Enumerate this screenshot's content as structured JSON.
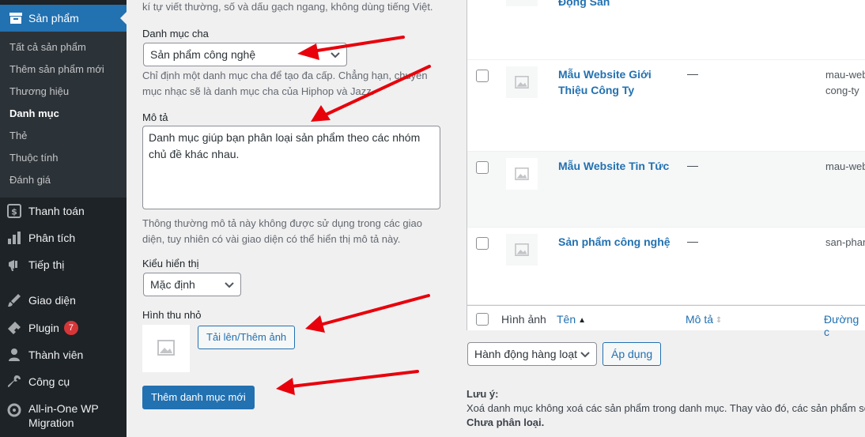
{
  "sidebar": {
    "current_menu": "Sản phẩm",
    "submenu": [
      {
        "label": "Tất cả sản phẩm",
        "current": false
      },
      {
        "label": "Thêm sản phẩm mới",
        "current": false
      },
      {
        "label": "Thương hiệu",
        "current": false
      },
      {
        "label": "Danh mục",
        "current": true
      },
      {
        "label": "Thẻ",
        "current": false
      },
      {
        "label": "Thuộc tính",
        "current": false
      },
      {
        "label": "Đánh giá",
        "current": false
      }
    ],
    "menu": [
      {
        "label": "Thanh toán",
        "icon": "payment-icon"
      },
      {
        "label": "Phân tích",
        "icon": "analytics-icon"
      },
      {
        "label": "Tiếp thị",
        "icon": "marketing-icon"
      },
      {
        "label": "Giao diện",
        "icon": "appearance-icon"
      },
      {
        "label": "Plugin",
        "icon": "plugin-icon",
        "badge": "7"
      },
      {
        "label": "Thành viên",
        "icon": "users-icon"
      },
      {
        "label": "Công cụ",
        "icon": "tools-icon"
      },
      {
        "label": "All-in-One WP Migration",
        "label_line1": "All-in-One WP",
        "label_line2": "Migration",
        "icon": "migration-icon"
      }
    ]
  },
  "form": {
    "slug_help": "kí tự viết thường, số và dấu gạch ngang, không dùng tiếng Việt.",
    "parent_label": "Danh mục cha",
    "parent_value": "Sản phẩm công nghệ",
    "parent_help_line1": "Chỉ định một danh mục cha để tạo đa cấp. Chẳng hạn, chuyên",
    "parent_help_line2": "mục nhạc sẽ là danh mục cha của Hiphop và Jazz.",
    "desc_label": "Mô tả",
    "desc_value_line1": "Danh mục giúp bạn phân loại sản phẩm theo các nhóm",
    "desc_value_line2": "chủ đề khác nhau.",
    "desc_help_line1": "Thông thường mô tả này không được sử dụng trong các giao",
    "desc_help_line2": "diện, tuy nhiên có vài giao diện có thể hiển thị mô tả này.",
    "display_label": "Kiểu hiển thị",
    "display_value": "Mặc định",
    "thumb_label": "Hình thu nhỏ",
    "upload_button": "Tải lên/Thêm ảnh",
    "submit_button": "Thêm danh mục mới"
  },
  "table": {
    "rows": [
      {
        "name": "Động Sản",
        "desc": "",
        "slug": ""
      },
      {
        "name_line1": "Mẫu Website Giới",
        "name_line2": "Thiệu Công Ty",
        "desc": "—",
        "slug_line1": "mau-web",
        "slug_line2": "cong-ty"
      },
      {
        "name": "Mẫu Website Tin Tức",
        "desc": "—",
        "slug": "mau-web"
      },
      {
        "name": "Sản phẩm công nghệ",
        "desc": "—",
        "slug": "san-phar"
      }
    ],
    "footer": {
      "image": "Hình ảnh",
      "name": "Tên",
      "desc": "Mô tả",
      "slug": "Đường c"
    },
    "bulk_action": "Hành động hàng loạt",
    "apply_button": "Áp dụng"
  },
  "note": {
    "title": "Lưu ý:",
    "line1": "Xoá danh mục không xoá các sản phẩm trong danh mục. Thay vào đó, các sản phẩm sẽ c",
    "line2": "Chưa phân loại."
  },
  "colors": {
    "accent": "#2271b1",
    "sidebar": "#1d2327",
    "arrow": "#e8000b"
  }
}
